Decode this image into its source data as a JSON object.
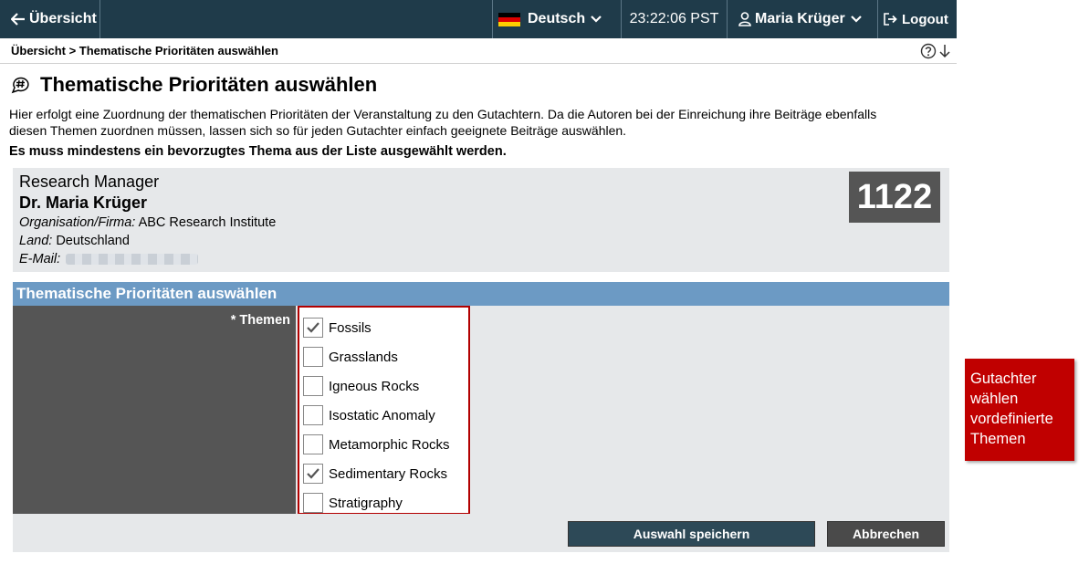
{
  "topbar": {
    "back_label": "Übersicht",
    "language": "Deutsch",
    "time": "23:22:06 PST",
    "user": "Maria Krüger",
    "logout": "Logout"
  },
  "breadcrumb": "Übersicht > Thematische Prioritäten auswählen",
  "page": {
    "title": "Thematische Prioritäten auswählen",
    "intro": "Hier erfolgt eine Zuordnung der thematischen Prioritäten der Veranstaltung zu den Gutachtern. Da die Autoren bei der Einreichung ihre Beiträge ebenfalls diesen Themen zuordnen müssen, lassen sich so für jeden Gutachter einfach geeignete Beiträge auswählen.",
    "warning": "Es muss mindestens ein bevorzugtes Thema aus der Liste ausgewählt werden."
  },
  "profile": {
    "role": "Research Manager",
    "name": "Dr. Maria Krüger",
    "org_label": "Organisation/Firma:",
    "org_value": "ABC Research Institute",
    "country_label": "Land:",
    "country_value": "Deutschland",
    "email_label": "E-Mail:",
    "id": "1122"
  },
  "section": {
    "title": "Thematische Prioritäten auswählen",
    "field_label": "* Themen",
    "options": [
      {
        "label": "Fossils",
        "checked": true
      },
      {
        "label": "Grasslands",
        "checked": false
      },
      {
        "label": "Igneous Rocks",
        "checked": false
      },
      {
        "label": "Isostatic Anomaly",
        "checked": false
      },
      {
        "label": "Metamorphic Rocks",
        "checked": false
      },
      {
        "label": "Sedimentary Rocks",
        "checked": true
      },
      {
        "label": "Stratigraphy",
        "checked": false
      }
    ]
  },
  "buttons": {
    "save": "Auswahl speichern",
    "cancel": "Abbrechen"
  },
  "callout": "Gutachter wählen vordefinierte Themen",
  "colors": {
    "topbar": "#1f3b4a",
    "section_header": "#6c9ac4",
    "callout": "#c00000"
  }
}
